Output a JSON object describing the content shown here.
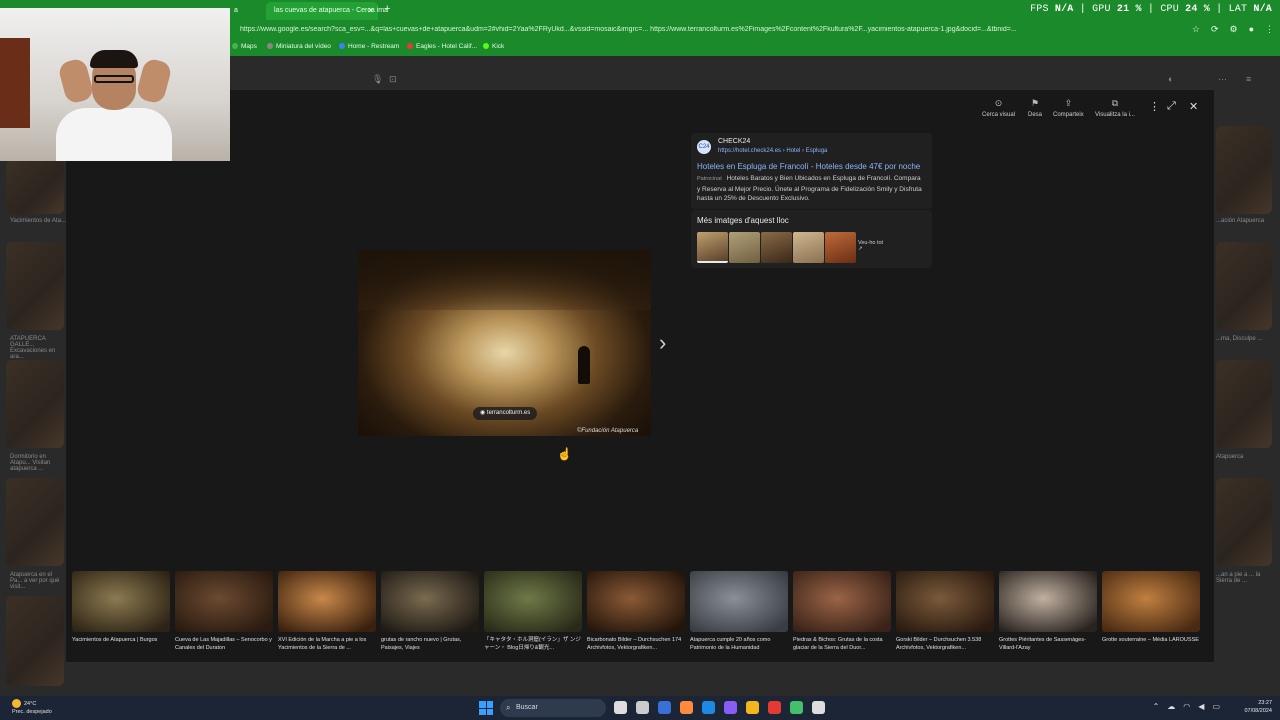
{
  "browser": {
    "tabs": [
      {
        "label": "a"
      },
      {
        "label": "las cuevas de atapuerca - Cerca ima"
      }
    ],
    "url": "https://www.google.es/search?sca_esv=...&q=las+cuevas+de+atapuerca&udm=2#vhid=2Yaa%2FRyUkd...&vssid=mosaic&imgrc=... https://www.terrancolturm.es%2Fimages%2Fcontent%2Fkultura%2F...yacimientos-atapuerca-1.jpg&docid=...&tbnid=...",
    "perf": {
      "fps_label": "FPS",
      "fps_value": "N/A",
      "gpu_label": "GPU",
      "gpu_value": "21 %",
      "cpu_label": "CPU",
      "cpu_value": "24 %",
      "lat_label": "LAT",
      "lat_value": "N/A"
    },
    "bookmarks": [
      {
        "label": "Maps",
        "color": "#4caf50"
      },
      {
        "label": "Miniatura del vídeo",
        "color": "#888888"
      },
      {
        "label": "Home - Restream",
        "color": "#3b82f6"
      },
      {
        "label": "Eagles - Hotel Calif...",
        "color": "#e53935"
      },
      {
        "label": "Kick",
        "color": "#53fc18"
      }
    ]
  },
  "viewer": {
    "tools": [
      {
        "label": "Cerca visual",
        "icon": "lens-icon"
      },
      {
        "label": "Desa",
        "icon": "bookmark-icon"
      },
      {
        "label": "Comparteix",
        "icon": "share-icon"
      },
      {
        "label": "Visualitza la i...",
        "icon": "open-icon"
      }
    ],
    "source_pill": "terrancolturm.es",
    "watermark": "©Fundación Atapuerca",
    "ad": {
      "logo_text": "C24",
      "source": "CHECK24",
      "source_url": "https://hotel.check24.es › Hotel › Espluga",
      "title": "Hoteles en Espluga de Francolí - Hoteles desde 47€ por noche",
      "sponsored": "Patrocinat",
      "description": "Hoteles Baratos y Bien Ubicados en Espluga de Francolí. Compara y Reserva al Mejor Precio. Únete al Programa de Fidelización Smily y Disfruta hasta un 25% de Descuento Exclusivo."
    },
    "more_images": {
      "heading": "Més imatges d'aquest lloc",
      "see_all": "Veu-ho tot",
      "thumb_colors": [
        "#8a6a3e",
        "#9a8a60",
        "#6b4f33",
        "#b89d70",
        "#a0522d"
      ]
    },
    "related": [
      {
        "caption": "Yacimientos de Atapuerca | Burgos",
        "c1": "#8c7a50",
        "c2": "#2e2416"
      },
      {
        "caption": "Cueva de Las Majadillas – Senocorbo y Canales del Duraton",
        "c1": "#6b4a30",
        "c2": "#2a1a10"
      },
      {
        "caption": "XVI Edición de la Marcha a pie a los Yacimientos de la Sierra de ...",
        "c1": "#c8884a",
        "c2": "#3a200e"
      },
      {
        "caption": "grutas de rancho nuevo | Grutas, Paisajes, Viajes",
        "c1": "#7a6a50",
        "c2": "#1e1a14"
      },
      {
        "caption": "「キャタタ・ホル洞窟(イラン」ザ ンジャーン・ Blog日帰り&観光...",
        "c1": "#6e7a48",
        "c2": "#2a2a18"
      },
      {
        "caption": "Bicarbonato Bilder – Durchsuchen 174 Archivfotos, Vektorgrafiken...",
        "c1": "#8a5a36",
        "c2": "#24150a"
      },
      {
        "caption": "Atapuerca cumple 20 años como Patrimonio de la Humanidad",
        "c1": "#8a9098",
        "c2": "#3a3e44"
      },
      {
        "caption": "Piedras & Bichos: Grutas de la costa glaciar de la Sierra del Duor...",
        "c1": "#9a6446",
        "c2": "#3a2218"
      },
      {
        "caption": "Gorski Bilder – Durchsuchen 3.538 Archivfotos, Vektorgrafiken...",
        "c1": "#7a5a3a",
        "c2": "#2a1a10"
      },
      {
        "caption": "Grottes Piéritantes de Sassenàges-Villard-l'Azay",
        "c1": "#c0b0a0",
        "c2": "#2a2420"
      },
      {
        "caption": "Grotte souterraine – Média LAROUSSE",
        "c1": "#c08040",
        "c2": "#4a2a12"
      }
    ]
  },
  "background": {
    "captions_left": [
      "Yacimientos de Ata...",
      "ATAPUERCA GALLE... Excavaciones en ara...",
      "Dormitorio en Atapu... Visitan atapuerca ...",
      "Atapuerca en el Pa... a ver por qué visit..."
    ],
    "captions_right": [
      "...ación Atapuerca",
      "...ma, Disculpe ...",
      "Atapuerca",
      "...an a pie a ... la Sierra de ..."
    ]
  },
  "taskbar": {
    "weather_temp": "24°C",
    "weather_desc": "Prec. despejado",
    "search_label": "Buscar",
    "time": "23:27",
    "date": "07/08/2024",
    "icon_colors": [
      "#dddddd",
      "#cccccc",
      "#3a6fd8",
      "#ff8a3c",
      "#1e88e5",
      "#8a5cf6",
      "#f2b51d",
      "#e53935",
      "#44c06a",
      "#dddddd"
    ]
  }
}
